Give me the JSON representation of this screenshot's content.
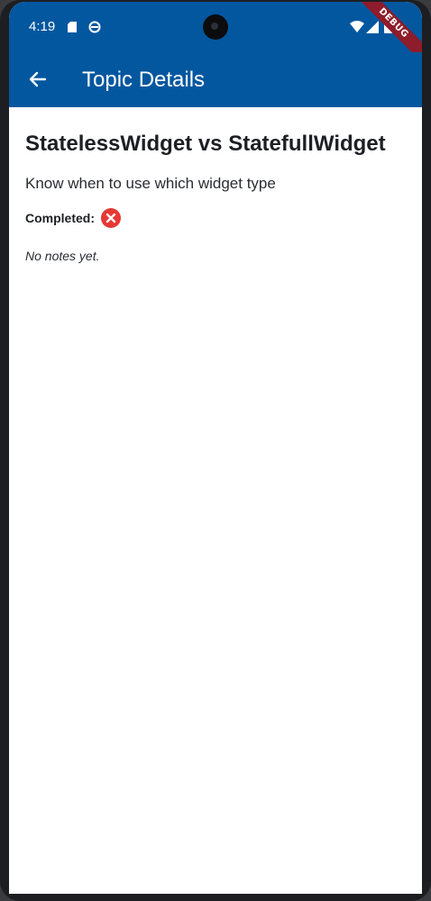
{
  "status_bar": {
    "time": "4:19",
    "icons": [
      "sd-card-icon",
      "sync-icon",
      "wifi-icon",
      "signal-icon",
      "battery-icon"
    ]
  },
  "debug_banner": "DEBUG",
  "app_bar": {
    "back_icon": "arrow-back-icon",
    "title": "Topic Details"
  },
  "topic": {
    "title": "StatelessWidget vs StatefullWidget",
    "description": "Know when to use which widget type",
    "completed_label": "Completed:",
    "completed_icon": "cancel-icon",
    "notes": "No notes yet."
  },
  "colors": {
    "app_bar": "#02579f",
    "not_completed": "#e53935",
    "debug_ribbon": "#8e1c2a"
  }
}
